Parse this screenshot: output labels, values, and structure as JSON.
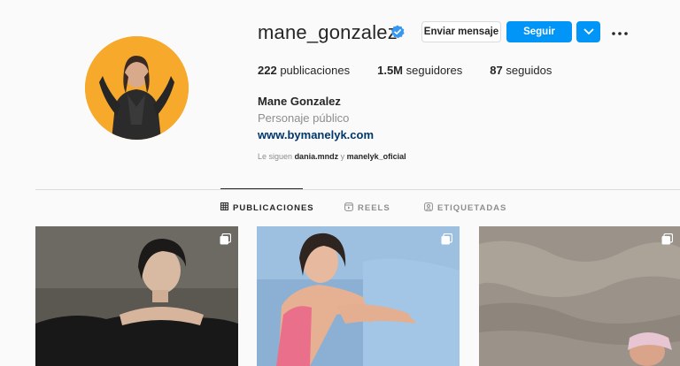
{
  "profile": {
    "username": "mane_gonzalez",
    "message_label": "Enviar mensaje",
    "follow_label": "Seguir",
    "stats": {
      "posts_value": "222",
      "posts_label": "publicaciones",
      "followers_value": "1.5M",
      "followers_label": "seguidores",
      "following_value": "87",
      "following_label": "seguidos"
    },
    "full_name": "Mane Gonzalez",
    "category": "Personaje público",
    "website": "www.bymanelyk.com",
    "followed_by_prefix": "Le siguen",
    "followed_by_user1": "dania.mndz",
    "followed_by_sep": "y",
    "followed_by_user2": "manelyk_oficial"
  },
  "tabs": {
    "posts": "PUBLICACIONES",
    "reels": "REELS",
    "tagged": "ETIQUETADAS"
  },
  "icons": {
    "verified": "verified-badge-icon",
    "suggest": "chevron-down-icon",
    "more": "more-horizontal-icon",
    "grid": "grid-icon",
    "reels": "reels-icon",
    "tagged": "tagged-icon",
    "multi": "multiple-photos-icon"
  },
  "colors": {
    "accent": "#0095f6",
    "link": "#00376b",
    "avatar_bg": "#f5a623"
  }
}
